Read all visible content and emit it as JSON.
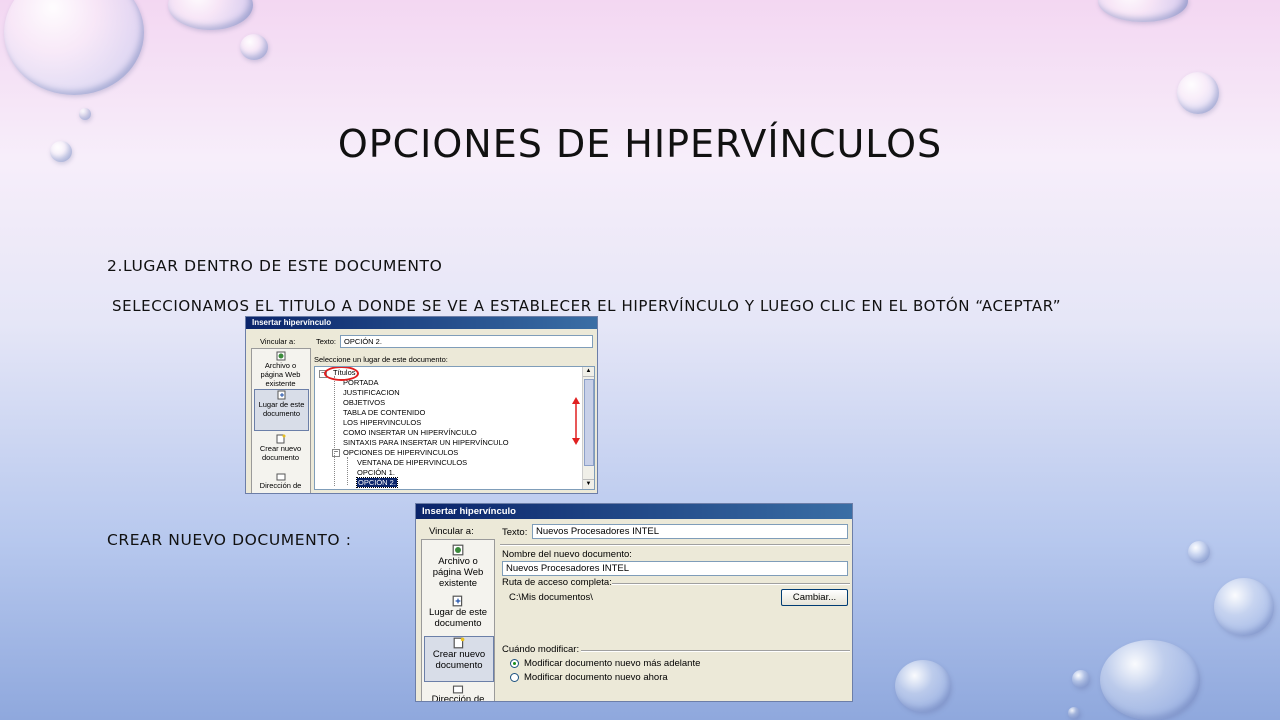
{
  "slide": {
    "title": "OPCIONES DE HIPERVÍNCULOS",
    "line1": "2.LUGAR DENTRO DE ESTE DOCUMENTO",
    "line2": "SELECCIONAMOS EL TITULO A DONDE SE VE A ESTABLECER EL HIPERVÍNCULO Y LUEGO CLIC EN EL BOTÓN “ACEPTAR”",
    "line3": "CREAR NUEVO DOCUMENTO :"
  },
  "dialog1": {
    "title": "Insertar hipervínculo",
    "link_to": "Vincular a:",
    "nav": [
      {
        "icon": "web-page-icon",
        "label": "Archivo o página Web existente"
      },
      {
        "icon": "document-place-icon",
        "label": "Lugar de este documento"
      },
      {
        "icon": "new-document-icon",
        "label": "Crear nuevo documento"
      },
      {
        "icon": "email-address-icon",
        "label": "Dirección de"
      }
    ],
    "text_label": "Texto:",
    "text_value": "OPCIÓN 2.",
    "select_label": "Seleccione un lugar de este documento:",
    "tree": [
      "Títulos",
      "PORTADA",
      "JUSTIFICACION",
      "OBJETIVOS",
      "TABLA DE CONTENIDO",
      "LOS HIPERVINCULOS",
      "COMO INSERTAR UN HIPERVÍNCULO",
      "SINTAXIS PARA INSERTAR UN HIPERVÍNCULO",
      "OPCIONES DE HIPERVINCULOS",
      "VENTANA DE HIPERVINCULOS",
      "OPCIÓN 1.",
      "OPCIÓN 2."
    ],
    "annotation_color": "#e02020"
  },
  "dialog2": {
    "title": "Insertar hipervínculo",
    "link_to": "Vincular a:",
    "nav": [
      {
        "icon": "web-page-icon",
        "label": "Archivo o página Web existente"
      },
      {
        "icon": "document-place-icon",
        "label": "Lugar de este documento"
      },
      {
        "icon": "new-document-icon",
        "label": "Crear nuevo documento"
      },
      {
        "icon": "email-address-icon",
        "label": "Dirección de"
      }
    ],
    "text_label": "Texto:",
    "text_value": "Nuevos Procesadores INTEL",
    "newdoc_label": "Nombre del nuevo documento:",
    "newdoc_value": "Nuevos Procesadores INTEL",
    "path_label": "Ruta de acceso completa:",
    "path_value": "C:\\Mis documentos\\",
    "change_button": "Cambiar...",
    "when_label": "Cuándo modificar:",
    "radio1": "Modificar documento nuevo más adelante",
    "radio2": "Modificar documento nuevo ahora"
  }
}
